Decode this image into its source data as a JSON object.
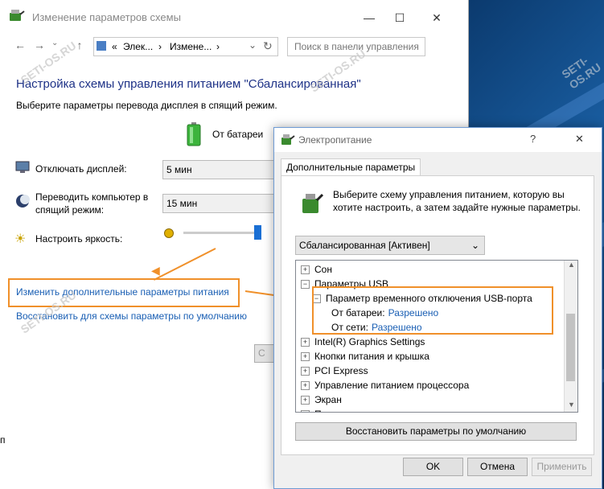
{
  "back_window": {
    "title": "Изменение параметров схемы",
    "controls": {
      "minimize": "—",
      "maximize": "☐",
      "close": "✕"
    },
    "nav": {
      "back": "←",
      "forward": "→",
      "up": "↑"
    },
    "breadcrumb": {
      "prefix": "«",
      "item1": "Элек...",
      "sep": "›",
      "item2": "Измене...",
      "dropdown": "⌄",
      "refresh": "↻"
    },
    "search_placeholder": "Поиск в панели управления",
    "heading": "Настройка схемы управления питанием \"Сбалансированная\"",
    "subheading": "Выберите параметры перевода дисплея в спящий режим.",
    "column_header": "От батареи",
    "rows": [
      {
        "label": "Отключать дисплей:",
        "value": "5 мин"
      },
      {
        "label_line1": "Переводить компьютер в",
        "label_line2": "спящий режим:",
        "value": "15 мин"
      },
      {
        "label": "Настроить яркость:"
      }
    ],
    "brightness": 0.92,
    "link_advanced": "Изменить дополнительные параметры питания",
    "link_restore": "Восстановить для схемы параметры по умолчанию",
    "partial_button": "С",
    "partial_left_text": "п"
  },
  "dialog": {
    "title": "Электропитание",
    "help": "?",
    "close": "✕",
    "tab": "Дополнительные параметры",
    "instruction_line1": "Выберите схему управления питанием, которую вы",
    "instruction_line2": "хотите настроить, а затем задайте нужные параметры.",
    "scheme_select": "Сбалансированная [Активен]",
    "tree": [
      {
        "sign": "+",
        "text": "Сон",
        "indent": 0
      },
      {
        "sign": "−",
        "text": "Параметры USB",
        "indent": 0
      },
      {
        "sign": "−",
        "text": "Параметр временного отключения USB-порта",
        "indent": 1
      },
      {
        "label": "От батареи:",
        "value": "Разрешено",
        "indent": 2
      },
      {
        "label": "От сети:",
        "value": "Разрешено",
        "indent": 2
      },
      {
        "sign": "+",
        "text": "Intel(R) Graphics Settings",
        "indent": 0
      },
      {
        "sign": "+",
        "text": "Кнопки питания и крышка",
        "indent": 0
      },
      {
        "sign": "+",
        "text": "PCI Express",
        "indent": 0
      },
      {
        "sign": "+",
        "text": "Управление питанием процессора",
        "indent": 0
      },
      {
        "sign": "+",
        "text": "Экран",
        "indent": 0
      },
      {
        "sign": "+",
        "text": "Параметры мультимедиа",
        "indent": 0
      }
    ],
    "restore_button": "Восстановить параметры по умолчанию",
    "ok_button": "OK",
    "cancel_button": "Отмена",
    "apply_button": "Применить"
  },
  "watermark": "SETI-OS.RU",
  "colors": {
    "accent_orange": "#f0902a",
    "link_blue": "#1a5fb4",
    "heading_blue": "#1e3287"
  }
}
